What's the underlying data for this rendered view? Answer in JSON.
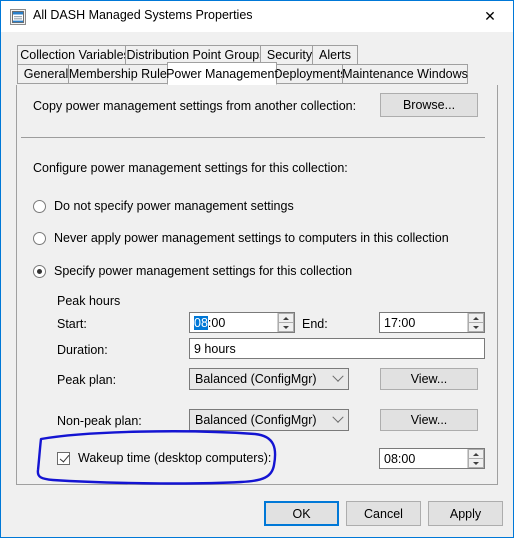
{
  "window": {
    "title": "All DASH Managed Systems Properties",
    "icon": "properties-window-icon",
    "close_label": "✕"
  },
  "tabs": {
    "row1": [
      {
        "label": "Collection Variables",
        "active": false
      },
      {
        "label": "Distribution Point Groups",
        "active": false
      },
      {
        "label": "Security",
        "active": false
      },
      {
        "label": "Alerts",
        "active": false
      }
    ],
    "row2": [
      {
        "label": "General",
        "active": false
      },
      {
        "label": "Membership Rules",
        "active": false
      },
      {
        "label": "Power Management",
        "active": true
      },
      {
        "label": "Deployments",
        "active": false
      },
      {
        "label": "Maintenance Windows",
        "active": false
      }
    ]
  },
  "panel": {
    "copy_label": "Copy power management settings from another collection:",
    "browse_button": "Browse...",
    "configure_label": "Configure power management settings for this collection:",
    "options": [
      {
        "label": "Do not specify power management settings",
        "selected": false
      },
      {
        "label": "Never apply power management settings to computers in this collection",
        "selected": false
      },
      {
        "label": "Specify power management settings for this collection",
        "selected": true
      }
    ],
    "peak_hours": {
      "group_label": "Peak hours",
      "start_label": "Start:",
      "start_value_selected": "08",
      "start_value_rest": ":00",
      "end_label": "End:",
      "end_value": "17:00",
      "duration_label": "Duration:",
      "duration_value": "9 hours"
    },
    "peak_plan": {
      "label": "Peak plan:",
      "value": "Balanced (ConfigMgr)",
      "view_button": "View..."
    },
    "nonpeak_plan": {
      "label": "Non-peak plan:",
      "value": "Balanced (ConfigMgr)",
      "view_button": "View..."
    },
    "wakeup": {
      "label": "Wakeup time (desktop computers):",
      "checked": true,
      "value": "08:00"
    }
  },
  "footer": {
    "ok": "OK",
    "cancel": "Cancel",
    "apply": "Apply"
  },
  "annotation": {
    "color": "#1414d2",
    "shape": "hand-drawn-ellipse-around-wakeup-time"
  }
}
